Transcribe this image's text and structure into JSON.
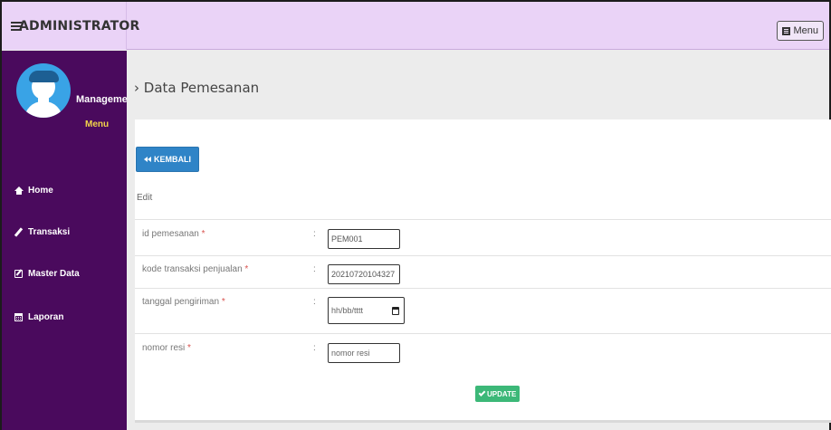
{
  "header": {
    "brand": "ADMINISTRATOR",
    "menu_button": "Menu"
  },
  "sidebar": {
    "panel_title": "Management",
    "panel_subtitle": "Menu",
    "items": [
      {
        "label": "Home",
        "icon": "home-icon"
      },
      {
        "label": "Transaksi",
        "icon": "pencil-icon"
      },
      {
        "label": "Master Data",
        "icon": "edit-icon"
      },
      {
        "label": "Laporan",
        "icon": "calendar-icon"
      }
    ]
  },
  "main": {
    "page_title": "› Data Pemesanan",
    "back_button": "KEMBALI",
    "section_label": "Edit",
    "fields": [
      {
        "label": "id pemesanan",
        "required": "*",
        "value": "PEM001"
      },
      {
        "label": "kode transaksi penjualan",
        "required": "*",
        "value": "20210720104327"
      },
      {
        "label": "tanggal pengiriman",
        "required": "*",
        "placeholder": "hh/bb/tttt"
      },
      {
        "label": "nomor resi",
        "required": "*",
        "placeholder": "nomor resi"
      }
    ],
    "colon": ":",
    "update_button": "UPDATE"
  },
  "colors": {
    "header_bg": "#ead3f7",
    "sidebar_bg": "#4a0a5d",
    "accent_yellow": "#f2d44a",
    "back_button": "#2f84c7",
    "update_button": "#3cb878"
  }
}
